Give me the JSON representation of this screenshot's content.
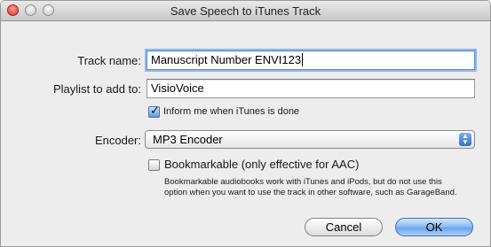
{
  "window": {
    "title": "Save Speech to iTunes Track"
  },
  "form": {
    "track_name_label": "Track name:",
    "track_name_value": "Manuscript Number ENVI123",
    "playlist_label": "Playlist to add to:",
    "playlist_value": "VisioVoice",
    "inform_label": "Inform me when iTunes is done",
    "inform_checked": true,
    "encoder_label": "Encoder:",
    "encoder_value": "MP3 Encoder",
    "bookmarkable_label": "Bookmarkable (only effective for AAC)",
    "bookmarkable_checked": false,
    "bookmarkable_note_line1": "Bookmarkable audiobooks work with iTunes and iPods, but do not use this",
    "bookmarkable_note_line2": "option when you want to use the track in other software, such as GarageBand."
  },
  "buttons": {
    "cancel": "Cancel",
    "ok": "OK"
  },
  "colors": {
    "accent": "#6aa6ee",
    "focus_ring": "#8fb6ec",
    "close_button": "#d8302a"
  }
}
